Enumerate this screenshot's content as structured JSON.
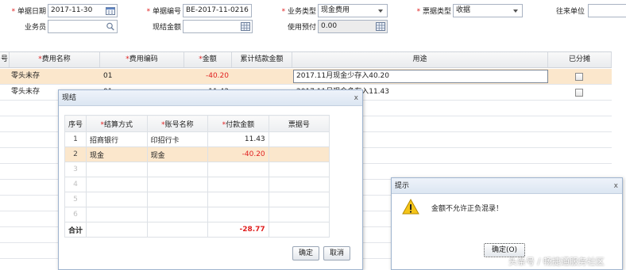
{
  "header": {
    "doc_date_label": "单据日期",
    "doc_date_value": "2017-11-30",
    "doc_no_label": "单据编号",
    "doc_no_value": "BE-2017-11-0216",
    "biz_type_label": "业务类型",
    "biz_type_value": "现金费用",
    "invoice_type_label": "票据类型",
    "invoice_type_value": "收据",
    "partner_label": "往来单位",
    "partner_value": "",
    "salesman_label": "业务员",
    "salesman_value": "",
    "settle_amount_label": "现结金额",
    "settle_amount_value": "",
    "prepay_label": "使用预付",
    "prepay_value": "0.00"
  },
  "grid": {
    "columns": {
      "no": "号",
      "fee_name": "费用名称",
      "fee_code": "费用编码",
      "amount": "金额",
      "settled": "累计结款金额",
      "purpose": "用途",
      "split": "已分摊"
    },
    "rows": [
      {
        "fee_name": "零头未存",
        "fee_code": "01",
        "amount": "-40.20",
        "settled": "",
        "purpose": "2017.11月现金少存入40.20"
      },
      {
        "fee_name": "零头未存",
        "fee_code": "01",
        "amount": "11.43",
        "settled": "",
        "purpose": "2017.11月现金多存入11.43"
      }
    ]
  },
  "settle_dialog": {
    "title": "现结",
    "close": "x",
    "columns": {
      "seq": "序号",
      "method": "结算方式",
      "account": "账号名称",
      "pay_amount": "付款金额",
      "ticket_no": "票据号"
    },
    "rows": [
      {
        "seq": "1",
        "method": "招商银行",
        "account": "印招行卡",
        "pay_amount": "11.43",
        "ticket_no": ""
      },
      {
        "seq": "2",
        "method": "现金",
        "account": "现金",
        "pay_amount": "-40.20",
        "ticket_no": ""
      },
      {
        "seq": "3"
      },
      {
        "seq": "4"
      },
      {
        "seq": "5"
      },
      {
        "seq": "6"
      }
    ],
    "total_label": "合计",
    "total_value": "-28.77",
    "ok_label": "确定",
    "cancel_label": "取消"
  },
  "alert_dialog": {
    "title": "提示",
    "close": "x",
    "message": "金额不允许正负混录！",
    "ok_label": "确定(O)"
  },
  "watermark": "头条号 / 畅捷通服务社区",
  "colors": {
    "required": "#e02020",
    "selected_row": "#fbe7cc",
    "negative": "#e02020"
  }
}
